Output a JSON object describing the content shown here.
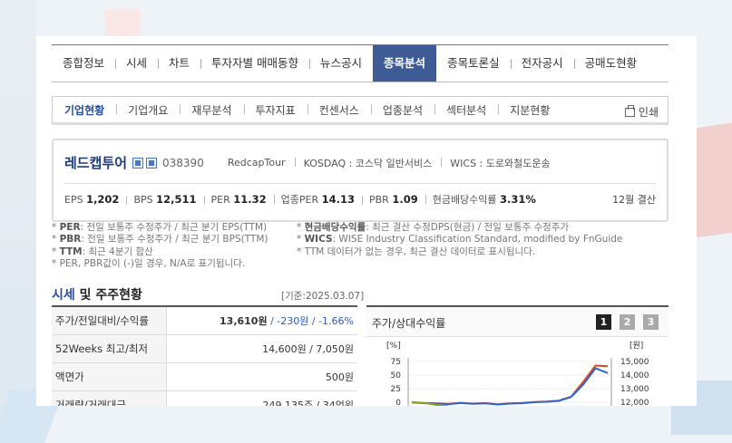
{
  "top_partial_text": "... ...(...)   ...",
  "main_tabs": [
    "종합정보",
    "시세",
    "차트",
    "투자자별 매매동향",
    "뉴스공시",
    "종목분석",
    "종목토론실",
    "전자공시",
    "공매도현황"
  ],
  "main_tab_active": "종목분석",
  "sub_tabs": [
    "기업현황",
    "기업개요",
    "재무분석",
    "투자지표",
    "컨센서스",
    "업종분석",
    "섹터분석",
    "지분현황"
  ],
  "sub_tab_active": "기업현황",
  "print_label": "인쇄",
  "company": {
    "name": "레드캡투어",
    "code": "038390",
    "english_name": "RedcapTour",
    "market": "KOSDAQ : 코스닥 일반서비스",
    "wics": "WICS : 도로와철도운송",
    "metrics": [
      {
        "label": "EPS",
        "value": "1,202"
      },
      {
        "label": "BPS",
        "value": "12,511"
      },
      {
        "label": "PER",
        "value": "11.32"
      },
      {
        "label": "업종PER",
        "value": "14.13"
      },
      {
        "label": "PBR",
        "value": "1.09"
      },
      {
        "label": "현금배당수익률",
        "value": "3.31%"
      }
    ],
    "settlement": "12월 결산"
  },
  "notes_left": [
    {
      "key": "PER",
      "text": ": 전일 보통주 수정주가 / 최근 분기 EPS(TTM)"
    },
    {
      "key": "PBR",
      "text": ": 전일 보통주 수정주가 / 최근 분기 BPS(TTM)"
    },
    {
      "key": "TTM",
      "text": ": 최근 4분기 합산"
    },
    {
      "key": "",
      "text": "PER, PBR값이 (-)일 경우, N/A로 표기됩니다."
    }
  ],
  "notes_right": [
    {
      "key": "현금배당수익률",
      "text": ": 최근 결산 수정DPS(현금) / 전일 보통주 수정주가"
    },
    {
      "key": "WICS",
      "text": ": WISE Industry Classification Standard, modified by FnGuide"
    },
    {
      "key": "",
      "text": "TTM 데이터가 없는 경우, 최근 결산 데이터로 표시됩니다."
    }
  ],
  "section": {
    "title_blue": "시세",
    "title_rest": " 및 주주현황",
    "date": "[기준:2025.03.07]"
  },
  "table": [
    {
      "label": "주가/전일대비/수익률",
      "value_main": "13,610원",
      "value_change": " / -230원 / -1.66%"
    },
    {
      "label": "52Weeks 최고/최저",
      "value_main": "14,600원 / 7,050원",
      "value_change": ""
    },
    {
      "label": "액면가",
      "value_main": "500원",
      "value_change": ""
    },
    {
      "label": "거래량/거래대금",
      "value_main": "249,135주 / 34억원",
      "value_change": ""
    }
  ],
  "chart_panel": {
    "title": "주가/상대수익률",
    "buttons": [
      "1",
      "2",
      "3"
    ],
    "active_button": "1",
    "left_unit": "[%]",
    "right_unit": "[원]",
    "left_ticks": [
      "75",
      "50",
      "25",
      "0"
    ],
    "right_ticks": [
      "15,000",
      "14,000",
      "13,000",
      "12,000"
    ]
  },
  "chart_data": {
    "type": "line",
    "ylabel_left": "[%]",
    "ylabel_right": "[원]",
    "ylim_left": [
      0,
      75
    ],
    "ylim_right": [
      12000,
      15000
    ],
    "series": [
      {
        "color": "#e0461c",
        "values": [
          12000,
          11950,
          11920,
          11880,
          11960,
          11900,
          11940,
          11850,
          11920,
          11950,
          12020,
          12050,
          12120,
          12400,
          13500,
          14700,
          14650
        ]
      },
      {
        "color": "#2b66d0",
        "values": [
          11980,
          11930,
          11900,
          11860,
          11940,
          11880,
          11910,
          11830,
          11900,
          11930,
          12000,
          12030,
          12100,
          12380,
          13300,
          14500,
          14150
        ]
      },
      {
        "color": "#8aa51e",
        "values": [
          12000,
          11950,
          11800,
          11700
        ]
      }
    ],
    "colors": {
      "stock": "#e0461c",
      "index": "#2b66d0",
      "relative": "#8aa51e"
    }
  }
}
